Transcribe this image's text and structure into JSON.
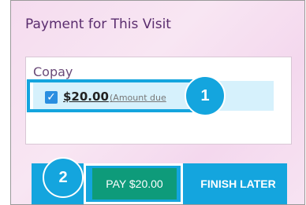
{
  "section_title": "Payment for This Visit",
  "copay": {
    "label": "Copay",
    "checked": true,
    "checkbox_glyph": "✓",
    "amount": "$20.00",
    "amount_note": "(Amount due"
  },
  "callouts": {
    "step1": "1",
    "step2": "2"
  },
  "actions": {
    "pay_label": "PAY $20.00",
    "finish_label": "FINISH LATER"
  },
  "colors": {
    "accent": "#14a5de",
    "pay_button": "#0e9b7a",
    "title_text": "#5a2d6e"
  }
}
